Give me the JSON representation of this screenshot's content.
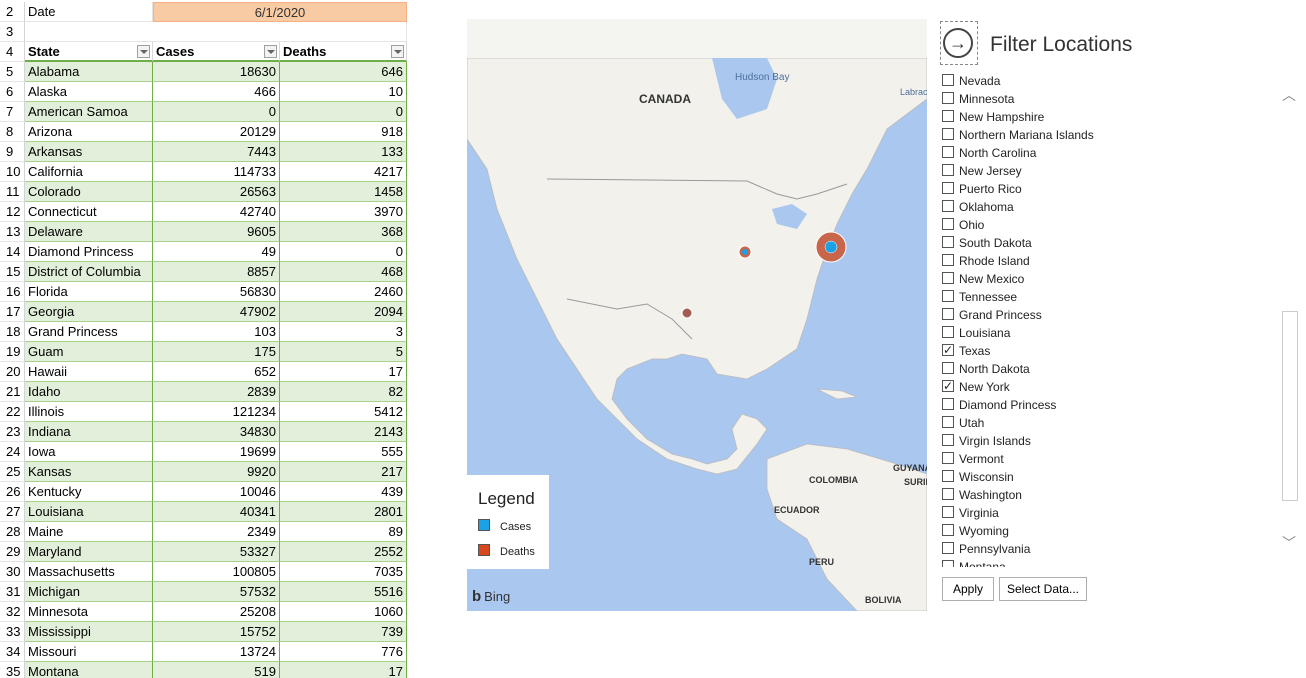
{
  "sheet": {
    "date_row": {
      "row_num": "2",
      "label": "Date",
      "value": "6/1/2020"
    },
    "empty_row": {
      "row_num": "3"
    },
    "header_row": {
      "row_num": "4",
      "col_state": "State",
      "col_cases": "Cases",
      "col_deaths": "Deaths"
    },
    "rows": [
      {
        "n": "5",
        "state": "Alabama",
        "cases": "18630",
        "deaths": "646"
      },
      {
        "n": "6",
        "state": "Alaska",
        "cases": "466",
        "deaths": "10"
      },
      {
        "n": "7",
        "state": "American Samoa",
        "cases": "0",
        "deaths": "0"
      },
      {
        "n": "8",
        "state": "Arizona",
        "cases": "20129",
        "deaths": "918"
      },
      {
        "n": "9",
        "state": "Arkansas",
        "cases": "7443",
        "deaths": "133"
      },
      {
        "n": "10",
        "state": "California",
        "cases": "114733",
        "deaths": "4217"
      },
      {
        "n": "11",
        "state": "Colorado",
        "cases": "26563",
        "deaths": "1458"
      },
      {
        "n": "12",
        "state": "Connecticut",
        "cases": "42740",
        "deaths": "3970"
      },
      {
        "n": "13",
        "state": "Delaware",
        "cases": "9605",
        "deaths": "368"
      },
      {
        "n": "14",
        "state": "Diamond Princess",
        "cases": "49",
        "deaths": "0"
      },
      {
        "n": "15",
        "state": "District of Columbia",
        "cases": "8857",
        "deaths": "468"
      },
      {
        "n": "16",
        "state": "Florida",
        "cases": "56830",
        "deaths": "2460"
      },
      {
        "n": "17",
        "state": "Georgia",
        "cases": "47902",
        "deaths": "2094"
      },
      {
        "n": "18",
        "state": "Grand Princess",
        "cases": "103",
        "deaths": "3"
      },
      {
        "n": "19",
        "state": "Guam",
        "cases": "175",
        "deaths": "5"
      },
      {
        "n": "20",
        "state": "Hawaii",
        "cases": "652",
        "deaths": "17"
      },
      {
        "n": "21",
        "state": "Idaho",
        "cases": "2839",
        "deaths": "82"
      },
      {
        "n": "22",
        "state": "Illinois",
        "cases": "121234",
        "deaths": "5412"
      },
      {
        "n": "23",
        "state": "Indiana",
        "cases": "34830",
        "deaths": "2143"
      },
      {
        "n": "24",
        "state": "Iowa",
        "cases": "19699",
        "deaths": "555"
      },
      {
        "n": "25",
        "state": "Kansas",
        "cases": "9920",
        "deaths": "217"
      },
      {
        "n": "26",
        "state": "Kentucky",
        "cases": "10046",
        "deaths": "439"
      },
      {
        "n": "27",
        "state": "Louisiana",
        "cases": "40341",
        "deaths": "2801"
      },
      {
        "n": "28",
        "state": "Maine",
        "cases": "2349",
        "deaths": "89"
      },
      {
        "n": "29",
        "state": "Maryland",
        "cases": "53327",
        "deaths": "2552"
      },
      {
        "n": "30",
        "state": "Massachusetts",
        "cases": "100805",
        "deaths": "7035"
      },
      {
        "n": "31",
        "state": "Michigan",
        "cases": "57532",
        "deaths": "5516"
      },
      {
        "n": "32",
        "state": "Minnesota",
        "cases": "25208",
        "deaths": "1060"
      },
      {
        "n": "33",
        "state": "Mississippi",
        "cases": "15752",
        "deaths": "739"
      },
      {
        "n": "34",
        "state": "Missouri",
        "cases": "13724",
        "deaths": "776"
      },
      {
        "n": "35",
        "state": "Montana",
        "cases": "519",
        "deaths": "17"
      }
    ]
  },
  "map": {
    "labels": {
      "canada": "CANADA",
      "hudson_bay": "Hudson Bay",
      "labrador": "Labrac",
      "colombia": "COLOMBIA",
      "ecuador": "ECUADOR",
      "peru": "PERU",
      "bolivia": "BOLIVIA",
      "guyana": "GUYANA",
      "surinam": "SURII"
    },
    "legend": {
      "title": "Legend",
      "cases": "Cases",
      "deaths": "Deaths"
    },
    "attribution": "Bing",
    "colors": {
      "cases": "#1aa1e6",
      "deaths": "#d9481c",
      "bubble": "#c9654a",
      "water": "#a9c7ef",
      "land": "#f2f1ec"
    }
  },
  "filter": {
    "title": "Filter Locations",
    "locations": [
      {
        "label": "Nevada",
        "checked": false
      },
      {
        "label": "Minnesota",
        "checked": false
      },
      {
        "label": "New Hampshire",
        "checked": false
      },
      {
        "label": "Northern Mariana Islands",
        "checked": false
      },
      {
        "label": "North Carolina",
        "checked": false
      },
      {
        "label": "New Jersey",
        "checked": false
      },
      {
        "label": "Puerto Rico",
        "checked": false
      },
      {
        "label": "Oklahoma",
        "checked": false
      },
      {
        "label": "Ohio",
        "checked": false
      },
      {
        "label": "South Dakota",
        "checked": false
      },
      {
        "label": "Rhode Island",
        "checked": false
      },
      {
        "label": "New Mexico",
        "checked": false
      },
      {
        "label": "Tennessee",
        "checked": false
      },
      {
        "label": "Grand Princess",
        "checked": false
      },
      {
        "label": "Louisiana",
        "checked": false
      },
      {
        "label": "Texas",
        "checked": true
      },
      {
        "label": "North Dakota",
        "checked": false
      },
      {
        "label": "New York",
        "checked": true
      },
      {
        "label": "Diamond Princess",
        "checked": false
      },
      {
        "label": "Utah",
        "checked": false
      },
      {
        "label": "Virgin Islands",
        "checked": false
      },
      {
        "label": "Vermont",
        "checked": false
      },
      {
        "label": "Wisconsin",
        "checked": false
      },
      {
        "label": "Washington",
        "checked": false
      },
      {
        "label": "Virginia",
        "checked": false
      },
      {
        "label": "Wyoming",
        "checked": false
      },
      {
        "label": "Pennsylvania",
        "checked": false
      },
      {
        "label": "Montana",
        "checked": false
      }
    ],
    "apply_label": "Apply",
    "select_data_label": "Select Data..."
  }
}
